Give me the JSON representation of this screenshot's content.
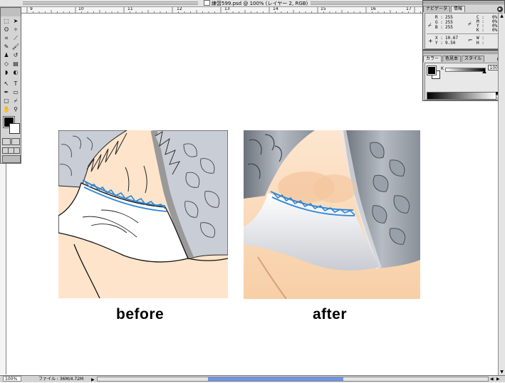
{
  "window": {
    "title": "練習599.psd @ 100% (レイヤー 2, RGB)"
  },
  "ruler": {
    "labels": [
      "9",
      "10",
      "11",
      "12",
      "13",
      "14",
      "15",
      "16",
      "17"
    ]
  },
  "navigator_panel": {
    "tabs": [
      "ナビゲータ",
      "情報"
    ],
    "rgb": [
      {
        "label": "R :",
        "value": "255"
      },
      {
        "label": "G :",
        "value": "255"
      },
      {
        "label": "B :",
        "value": "255"
      }
    ],
    "cmyk": [
      {
        "label": "C :",
        "value": "0%"
      },
      {
        "label": "M :",
        "value": "0%"
      },
      {
        "label": "Y :",
        "value": "0%"
      },
      {
        "label": "K :",
        "value": "0%"
      }
    ],
    "xy": [
      {
        "label": "X :",
        "value": "10.67"
      },
      {
        "label": "Y :",
        "value": "9.50"
      }
    ],
    "wh": [
      {
        "label": "W :",
        "value": ""
      },
      {
        "label": "H :",
        "value": ""
      }
    ]
  },
  "color_panel": {
    "tabs": [
      "カラー",
      "色見本",
      "スタイル"
    ],
    "channel_label": "K",
    "channel_value": "100",
    "channel_level": 1.0
  },
  "captions": {
    "before": "before",
    "after": "after"
  },
  "status": {
    "zoom": "100%",
    "file_info": "ファイル : 36M/4.72M"
  },
  "colors": {
    "cloth_blue": "#2f86d6",
    "skin": "#fde4cb",
    "scale_gray": "#c9cdd5",
    "toolbar_gray": "#d4d4d4"
  }
}
